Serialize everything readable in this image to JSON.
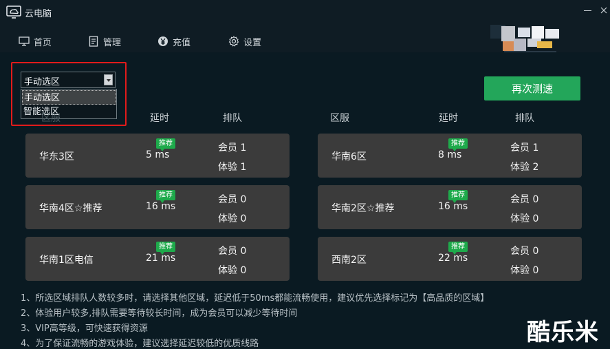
{
  "app": {
    "title": "云电脑"
  },
  "nav": {
    "items": [
      {
        "label": "首页",
        "icon": "monitor-icon"
      },
      {
        "label": "管理",
        "icon": "document-icon"
      },
      {
        "label": "充值",
        "icon": "yen-icon"
      },
      {
        "label": "设置",
        "icon": "gear-icon"
      }
    ]
  },
  "region_select": {
    "value": "手动选区",
    "options": [
      "手动选区",
      "智能选区"
    ]
  },
  "retest_label": "再次测速",
  "columns": {
    "left": [
      "区服",
      "延时",
      "排队"
    ],
    "right": [
      "区服",
      "延时",
      "排队"
    ]
  },
  "servers": [
    {
      "name": "华东3区",
      "latency": "5 ms",
      "badge": "推荐",
      "vip": "会员 1",
      "trial": "体验 1"
    },
    {
      "name": "华南6区",
      "latency": "8 ms",
      "badge": "推荐",
      "vip": "会员 1",
      "trial": "体验 2"
    },
    {
      "name": "华南4区☆推荐",
      "latency": "16 ms",
      "badge": "推荐",
      "vip": "会员 0",
      "trial": "体验 0"
    },
    {
      "name": "华南2区☆推荐",
      "latency": "16 ms",
      "badge": "推荐",
      "vip": "会员 0",
      "trial": "体验 0"
    },
    {
      "name": "华南1区电信",
      "latency": "21 ms",
      "badge": "推荐",
      "vip": "会员 0",
      "trial": "体验 0"
    },
    {
      "name": "西南2区",
      "latency": "22 ms",
      "badge": "推荐",
      "vip": "会员 0",
      "trial": "体验 0"
    }
  ],
  "notes": [
    "1、所选区域排队人数较多时，请选择其他区域，延迟低于50ms都能流畅使用，建议优先选择标记为【高品质的区域】",
    "2、体验用户较多,排队需要等待较长时间，成为会员可以减少等待时间",
    "3、VIP高等级，可快速获得资源",
    "4、为了保证流畅的游戏体验，建议选择延迟较低的优质线路"
  ],
  "watermark": "酷乐米",
  "colors": {
    "accent_green": "#23a65a",
    "badge_green": "#1eaa4b",
    "card_bg": "#3b3b3b",
    "highlight_red": "#e21b1b"
  }
}
